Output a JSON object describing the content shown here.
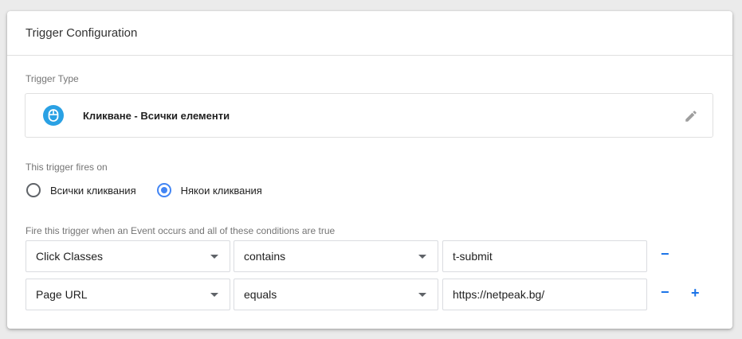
{
  "header": {
    "title": "Trigger Configuration"
  },
  "trigger_type": {
    "label": "Trigger Type",
    "name": "Кликване - Всички елементи",
    "icon": "mouse-icon",
    "edit_icon": "pencil-icon",
    "icon_color": "#2aa1e4"
  },
  "fires_on": {
    "label": "This trigger fires on",
    "options": [
      {
        "label": "Всички кликвания",
        "checked": false
      },
      {
        "label": "Някои кликвания",
        "checked": true
      }
    ]
  },
  "conditions": {
    "label": "Fire this trigger when an Event occurs and all of these conditions are true",
    "rows": [
      {
        "variable": "Click Classes",
        "operator": "contains",
        "value": "t-submit",
        "remove": "−",
        "add": ""
      },
      {
        "variable": "Page URL",
        "operator": "equals",
        "value": "https://netpeak.bg/",
        "remove": "−",
        "add": "+"
      }
    ]
  },
  "colors": {
    "accent": "#4285f4",
    "link": "#1a73e8"
  }
}
